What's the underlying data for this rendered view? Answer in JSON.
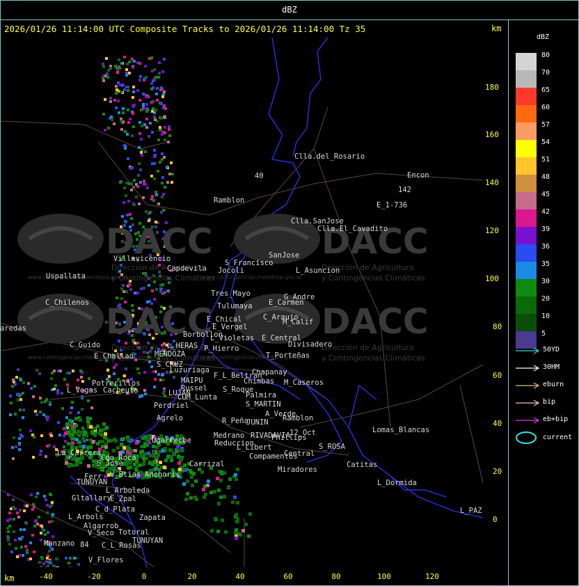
{
  "window": {
    "title": "dBZ"
  },
  "header": {
    "text": "2026/01/26 11:14:00 UTC Composite Tracks to 2026/01/26 11:14:00 Tz 35",
    "km_top": "km",
    "km_bottom": "km"
  },
  "axes": {
    "y_ticks": [
      "180",
      "160",
      "140",
      "120",
      "100",
      "80",
      "60",
      "40",
      "20",
      "0"
    ],
    "x_ticks": [
      "-40",
      "-20",
      "0",
      "20",
      "40",
      "60",
      "80",
      "100",
      "120"
    ]
  },
  "places": [
    "Clla.del_Rosario",
    "Encon",
    "142",
    "E_1-736",
    "Ramblon",
    "40",
    "Clla.SanJose",
    "Clla.El_Cavadito",
    "SanJose",
    "S_Francisco",
    "Villavicencio",
    "Capdevila",
    "Jocoli",
    "L_Asuncion",
    "Uspallata",
    "Tres_Mayo",
    "G_Andre",
    "C_Chilenos",
    "Tulumaya",
    "E_Carmen",
    "E_Chical",
    "C_Araujo",
    "M_Calif",
    "E_Vergel",
    "aredas",
    "Borbollon",
    "L_Violetas",
    "E_Central",
    "Divisadero",
    "C_Guido",
    "L_HERAS",
    "P_Hierro",
    "MENDOZA",
    "E_Challao",
    "T_Porteñas",
    "S_CRUZ",
    "Luzuriaga",
    "Chapanay",
    "F_L_Beltran",
    "MAIPU",
    "Chimbas",
    "M_Caseros",
    "Potrerillos",
    "L_Vegas",
    "Cacheuta",
    "Russel",
    "S_Roque",
    "LUJAN",
    "Palmira",
    "CUM_Lunta",
    "S_MARTIN",
    "Perdriel",
    "A_Verde",
    "Agrelo",
    "R_Peña",
    "JUNIN",
    "Ramblon",
    "Lomas_Blancas",
    "Medrano",
    "RIVADAVIA",
    "Phillips",
    "12_Oct",
    "Ugarteche",
    "Reduccion",
    "L_Libert",
    "S_ROSA",
    "La_Carrera",
    "Cdo_Roca",
    "Compamentos",
    "Central",
    "S_Jose",
    "Carrizal",
    "Catitas",
    "V_Btias",
    "Anchoris",
    "Miradores",
    "Ferr",
    "TUNUYAN",
    "L_Dormida",
    "L_Arboleda",
    "Gltallary",
    "E_Zpal",
    "C_d_Plata",
    "L_Arbols",
    "Zapata",
    "L_PAZ",
    "Algarrob",
    "V_Seco",
    "Totoral",
    "TUNUYAN",
    "Manzano",
    "C_L_Rosas",
    "V_Flores",
    "84"
  ],
  "watermark": {
    "brand": "DACC",
    "line1": "Dirección de Agricultura",
    "line2": "y Contingencias Climáticas",
    "small_url": "www.contingencias.mendoza.gov.ar"
  },
  "legend": {
    "title": "dBZ",
    "levels": [
      {
        "label": "80",
        "color": "#d4d4d4"
      },
      {
        "label": "70",
        "color": "#b8b8b8"
      },
      {
        "label": "65",
        "color": "#ff3a2a"
      },
      {
        "label": "60",
        "color": "#ff6a10"
      },
      {
        "label": "57",
        "color": "#ff9a60"
      },
      {
        "label": "54",
        "color": "#ffff00"
      },
      {
        "label": "51",
        "color": "#ffc42a"
      },
      {
        "label": "48",
        "color": "#d09040"
      },
      {
        "label": "45",
        "color": "#c86a8a"
      },
      {
        "label": "42",
        "color": "#d8188c"
      },
      {
        "label": "39",
        "color": "#7a10d0"
      },
      {
        "label": "36",
        "color": "#2a4cf0"
      },
      {
        "label": "35",
        "color": "#1a8ae6"
      },
      {
        "label": "30",
        "color": "#0e8a10"
      },
      {
        "label": "20",
        "color": "#0a6a0a"
      },
      {
        "label": "10",
        "color": "#0a4e0a"
      },
      {
        "label": "5",
        "color": "#4a3a90"
      }
    ],
    "tracks": [
      {
        "label": "50YD",
        "color": "#40d8d8"
      },
      {
        "label": "30HM",
        "color": "#ffffff"
      },
      {
        "label": "eburn",
        "color": "#e0c080"
      },
      {
        "label": "bip",
        "color": "#ffc0c8"
      },
      {
        "label": "eb+bip",
        "color": "#e040e0"
      }
    ],
    "current_label": "current",
    "current_color": "#40e0e0"
  }
}
